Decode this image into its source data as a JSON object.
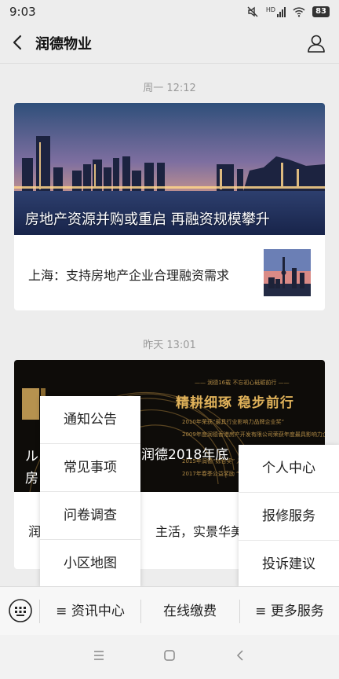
{
  "status_bar": {
    "time": "9:03",
    "network_label": "HD",
    "battery": "83"
  },
  "header": {
    "title": "润德物业"
  },
  "messages": [
    {
      "timestamp": "周一 12:12",
      "hero_title": "房地产资源并购或重启 再融资规模攀升",
      "sub_title": "上海：支持房地产企业合理融资需求"
    },
    {
      "timestamp": "昨天 13:01",
      "hero_heading": "精耕细琢 稳步前行",
      "hero_small_top": "—— 润德16载 不忘初心砥砺前行 ——",
      "hero_awards": [
        "2010年荣获“最具行业影响力品牌企业奖”",
        "2009年度润德香港房产开发有限公司荣获年度最具影响力企业",
        "2015年润德“综合奖” 入选",
        "2017年春季公益奖励 “行业品牌”"
      ],
      "hero_title_partial": "润德2018年底",
      "hero_left_partial_top": "ル",
      "hero_left_partial_bottom": "房",
      "text_partial_left": "润",
      "text_partial_right": "主活，实景华美绽放"
    }
  ],
  "popup_left": {
    "items": [
      "通知公告",
      "常见事项",
      "问卷调查",
      "小区地图"
    ]
  },
  "popup_right": {
    "items": [
      "个人中心",
      "报修服务",
      "投诉建议"
    ]
  },
  "menu_bar": {
    "items": [
      "≡ 资讯中心",
      "在线缴费",
      "≡ 更多服务"
    ]
  }
}
